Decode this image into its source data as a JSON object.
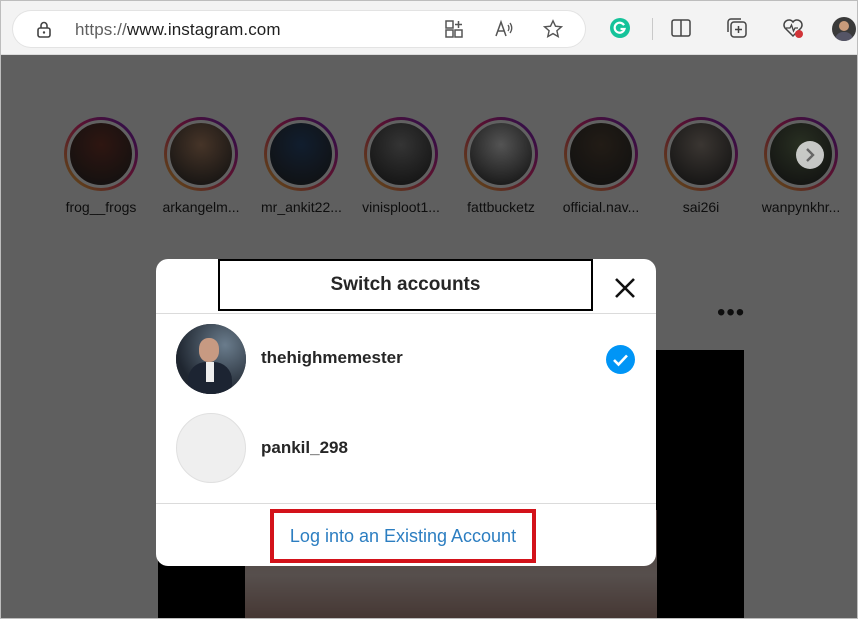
{
  "browser": {
    "url_protocol": "https://",
    "url_host": "www.instagram.com",
    "colors": {
      "grammarly": "#15c39a",
      "notification_badge": "#d13438"
    }
  },
  "stories": [
    {
      "username": "frog__frogs",
      "color": "#7a3a2e"
    },
    {
      "username": "arkangelm...",
      "color": "#b88a6a"
    },
    {
      "username": "mr_ankit22...",
      "color": "#2f4f7a"
    },
    {
      "username": "vinisploot1...",
      "color": "#8a8a8a"
    },
    {
      "username": "fattbucketz",
      "color": "#dcdcdc"
    },
    {
      "username": "official.nav...",
      "color": "#5a4a3a"
    },
    {
      "username": "sai26i",
      "color": "#9a8e84"
    },
    {
      "username": "wanpynkhr...",
      "color": "#6b7d5a"
    }
  ],
  "post_menu_icon": "more-horizontal-icon",
  "modal": {
    "title": "Switch accounts",
    "accounts": [
      {
        "username": "thehighmemester",
        "selected": true
      },
      {
        "username": "pankil_298",
        "selected": false
      }
    ],
    "login_link": "Log into an Existing Account",
    "colors": {
      "check": "#0095f6",
      "link": "#2c7ec1",
      "highlight_border": "#d3121a"
    }
  }
}
